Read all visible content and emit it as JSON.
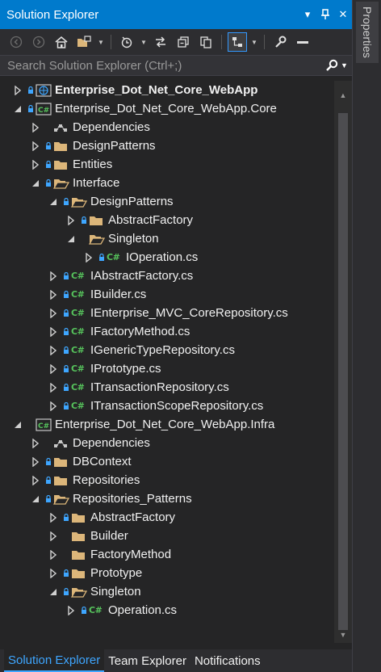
{
  "window": {
    "title": "Solution Explorer",
    "properties_tab": "Properties"
  },
  "search": {
    "placeholder": "Search Solution Explorer (Ctrl+;)"
  },
  "tree": [
    {
      "depth": 0,
      "expanded": false,
      "icon": "web-project-icon",
      "label": "Enterprise_Dot_Net_Core_WebApp",
      "bold": true,
      "locked": true
    },
    {
      "depth": 0,
      "expanded": true,
      "icon": "csharp-project-icon",
      "label": "Enterprise_Dot_Net_Core_WebApp.Core",
      "locked": true
    },
    {
      "depth": 1,
      "expanded": false,
      "icon": "dependencies-icon",
      "label": "Dependencies",
      "locked": false
    },
    {
      "depth": 1,
      "expanded": false,
      "icon": "folder-icon",
      "label": "DesignPatterns",
      "locked": true
    },
    {
      "depth": 1,
      "expanded": false,
      "icon": "folder-icon",
      "label": "Entities",
      "locked": true
    },
    {
      "depth": 1,
      "expanded": true,
      "icon": "folder-open-icon",
      "label": "Interface",
      "locked": true
    },
    {
      "depth": 2,
      "expanded": true,
      "icon": "folder-open-icon",
      "label": "DesignPatterns",
      "locked": true
    },
    {
      "depth": 3,
      "expanded": false,
      "icon": "folder-icon",
      "label": "AbstractFactory",
      "locked": true
    },
    {
      "depth": 3,
      "expanded": true,
      "icon": "folder-open-icon",
      "label": "Singleton",
      "locked": false
    },
    {
      "depth": 4,
      "expanded": false,
      "icon": "csharp-file-icon",
      "label": "IOperation.cs",
      "locked": true
    },
    {
      "depth": 2,
      "expanded": false,
      "icon": "csharp-file-icon",
      "label": "IAbstractFactory.cs",
      "locked": true
    },
    {
      "depth": 2,
      "expanded": false,
      "icon": "csharp-file-icon",
      "label": "IBuilder.cs",
      "locked": true
    },
    {
      "depth": 2,
      "expanded": false,
      "icon": "csharp-file-icon",
      "label": "IEnterprise_MVC_CoreRepository.cs",
      "locked": true
    },
    {
      "depth": 2,
      "expanded": false,
      "icon": "csharp-file-icon",
      "label": "IFactoryMethod.cs",
      "locked": true
    },
    {
      "depth": 2,
      "expanded": false,
      "icon": "csharp-file-icon",
      "label": "IGenericTypeRepository.cs",
      "locked": true
    },
    {
      "depth": 2,
      "expanded": false,
      "icon": "csharp-file-icon",
      "label": "IPrototype.cs",
      "locked": true
    },
    {
      "depth": 2,
      "expanded": false,
      "icon": "csharp-file-icon",
      "label": "ITransactionRepository.cs",
      "locked": true
    },
    {
      "depth": 2,
      "expanded": false,
      "icon": "csharp-file-icon",
      "label": "ITransactionScopeRepository.cs",
      "locked": true
    },
    {
      "depth": 0,
      "expanded": true,
      "icon": "csharp-project-icon",
      "label": "Enterprise_Dot_Net_Core_WebApp.Infra",
      "locked": false
    },
    {
      "depth": 1,
      "expanded": false,
      "icon": "dependencies-icon",
      "label": "Dependencies",
      "locked": false
    },
    {
      "depth": 1,
      "expanded": false,
      "icon": "folder-icon",
      "label": "DBContext",
      "locked": true
    },
    {
      "depth": 1,
      "expanded": false,
      "icon": "folder-icon",
      "label": "Repositories",
      "locked": true
    },
    {
      "depth": 1,
      "expanded": true,
      "icon": "folder-open-icon",
      "label": "Repositories_Patterns",
      "locked": true
    },
    {
      "depth": 2,
      "expanded": false,
      "icon": "folder-icon",
      "label": "AbstractFactory",
      "locked": true
    },
    {
      "depth": 2,
      "expanded": false,
      "icon": "folder-icon",
      "label": "Builder",
      "locked": false
    },
    {
      "depth": 2,
      "expanded": false,
      "icon": "folder-icon",
      "label": "FactoryMethod",
      "locked": false
    },
    {
      "depth": 2,
      "expanded": false,
      "icon": "folder-icon",
      "label": "Prototype",
      "locked": true
    },
    {
      "depth": 2,
      "expanded": true,
      "icon": "folder-open-icon",
      "label": "Singleton",
      "locked": true
    },
    {
      "depth": 3,
      "expanded": false,
      "icon": "csharp-file-icon",
      "label": "Operation.cs",
      "locked": true
    }
  ],
  "bottom_tabs": [
    {
      "label": "Solution Explorer",
      "active": true
    },
    {
      "label": "Team Explorer",
      "active": false
    },
    {
      "label": "Notifications",
      "active": false
    }
  ],
  "colors": {
    "accent": "#007acc",
    "background": "#252526",
    "folder": "#dcb67a",
    "csharp": "#56c35c",
    "lock": "#3ea6ff"
  }
}
